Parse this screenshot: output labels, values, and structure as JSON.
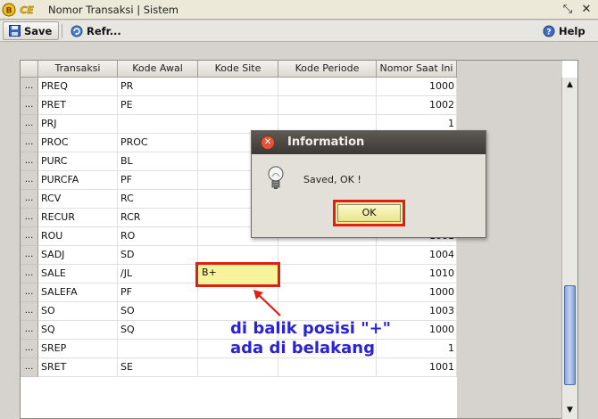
{
  "window": {
    "logo_text": "BCE",
    "title": "Nomor Transaksi | Sistem"
  },
  "toolbar": {
    "save_label": "Save",
    "refresh_label": "Refr...",
    "help_label": "Help"
  },
  "table": {
    "columns": [
      "Transaksi",
      "Kode Awal",
      "Kode Site",
      "Kode Periode",
      "Nomor Saat Ini"
    ],
    "selector_text": "...",
    "rows": [
      {
        "transaksi": "PREQ",
        "kode_awal": "PR",
        "kode_site": "",
        "kode_periode": "",
        "nomor": "1000"
      },
      {
        "transaksi": "PRET",
        "kode_awal": "PE",
        "kode_site": "",
        "kode_periode": "",
        "nomor": "1002"
      },
      {
        "transaksi": "PRJ",
        "kode_awal": "",
        "kode_site": "",
        "kode_periode": "",
        "nomor": "1"
      },
      {
        "transaksi": "PROC",
        "kode_awal": "PROC",
        "kode_site": "",
        "kode_periode": "",
        "nomor": ""
      },
      {
        "transaksi": "PURC",
        "kode_awal": "BL",
        "kode_site": "",
        "kode_periode": "",
        "nomor": ""
      },
      {
        "transaksi": "PURCFA",
        "kode_awal": "PF",
        "kode_site": "",
        "kode_periode": "",
        "nomor": ""
      },
      {
        "transaksi": "RCV",
        "kode_awal": "RC",
        "kode_site": "",
        "kode_periode": "",
        "nomor": ""
      },
      {
        "transaksi": "RECUR",
        "kode_awal": "RCR",
        "kode_site": "",
        "kode_periode": "",
        "nomor": ""
      },
      {
        "transaksi": "ROU",
        "kode_awal": "RO",
        "kode_site": "",
        "kode_periode": "",
        "nomor": "1001"
      },
      {
        "transaksi": "SADJ",
        "kode_awal": "SD",
        "kode_site": "",
        "kode_periode": "",
        "nomor": "1004"
      },
      {
        "transaksi": "SALE",
        "kode_awal": "/JL",
        "kode_site": "B+",
        "kode_periode": "",
        "nomor": "1010"
      },
      {
        "transaksi": "SALEFA",
        "kode_awal": "PF",
        "kode_site": "",
        "kode_periode": "",
        "nomor": "1000"
      },
      {
        "transaksi": "SO",
        "kode_awal": "SO",
        "kode_site": "",
        "kode_periode": "",
        "nomor": "1003"
      },
      {
        "transaksi": "SQ",
        "kode_awal": "SQ",
        "kode_site": "",
        "kode_periode": "",
        "nomor": "1000"
      },
      {
        "transaksi": "SREP",
        "kode_awal": "",
        "kode_site": "",
        "kode_periode": "",
        "nomor": "1"
      },
      {
        "transaksi": "SRET",
        "kode_awal": "SE",
        "kode_site": "",
        "kode_periode": "",
        "nomor": "1001"
      }
    ]
  },
  "dialog": {
    "title": "Information",
    "message": "Saved, OK !",
    "ok_label": "OK"
  },
  "annotation": {
    "line1": "di balik posisi \"+\"",
    "line2": "ada di belakang",
    "color": "#2a22d6",
    "highlight_color": "#e21d12"
  }
}
